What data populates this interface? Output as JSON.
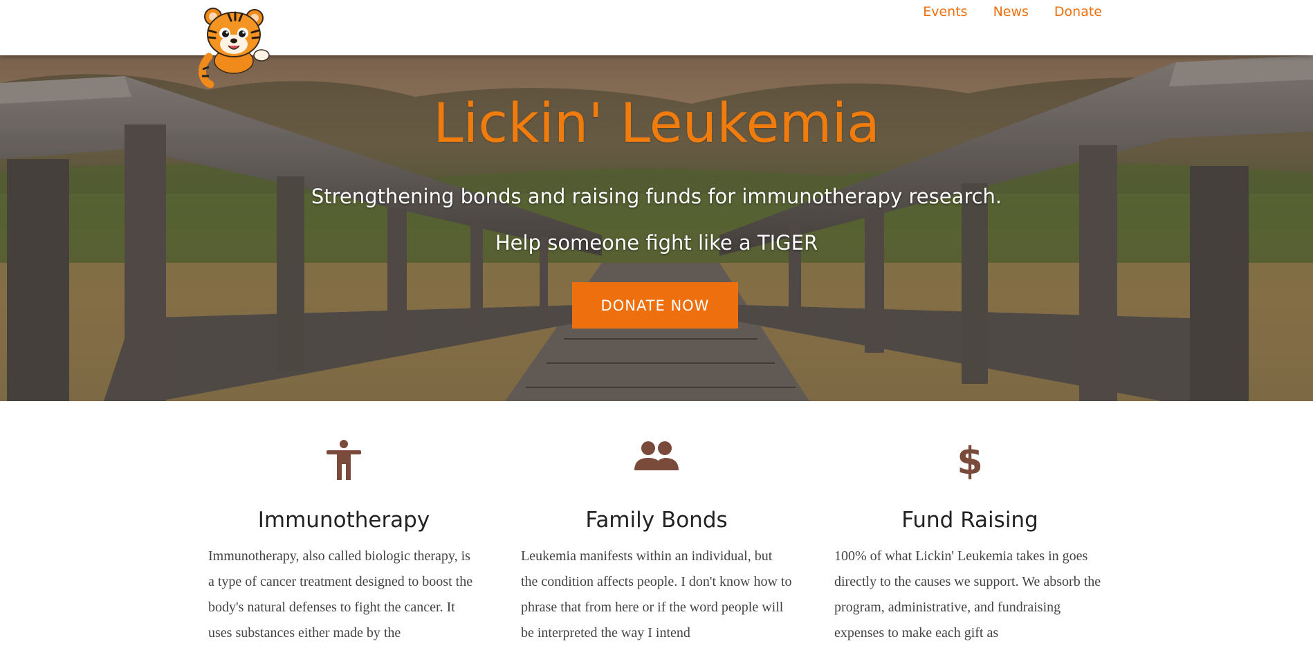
{
  "brand": {
    "logo_icon": "tiger-mascot-icon"
  },
  "nav": {
    "items": [
      {
        "label": "Events"
      },
      {
        "label": "News"
      },
      {
        "label": "Donate"
      }
    ]
  },
  "hero": {
    "title": "Lickin' Leukemia",
    "subtitle": "Strengthening bonds and raising funds for immunotherapy research.",
    "tagline": "Help someone fight like a TIGER",
    "cta_label": "DONATE NOW"
  },
  "features": [
    {
      "icon": "accessibility-person-icon",
      "title": "Immunotherapy",
      "text": "Immunotherapy, also called biologic therapy, is a type of cancer treatment designed to boost the body's natural defenses to fight the cancer. It uses substances either made by the"
    },
    {
      "icon": "people-group-icon",
      "title": "Family Bonds",
      "text": "Leukemia manifests within an individual, but the condition affects people. I don't know how to phrase that from here or if the word people will be interpreted the way I intend"
    },
    {
      "icon": "dollar-sign-icon",
      "title": "Fund Raising",
      "text": "100% of what Lickin' Leukemia takes in goes directly to the causes we support. We absorb the program, administrative, and fundraising expenses to make each gift as"
    }
  ],
  "colors": {
    "accent": "#ee6f0d",
    "icon_brown": "#7a4a3a",
    "heading": "#222222",
    "body_text": "#444444"
  }
}
